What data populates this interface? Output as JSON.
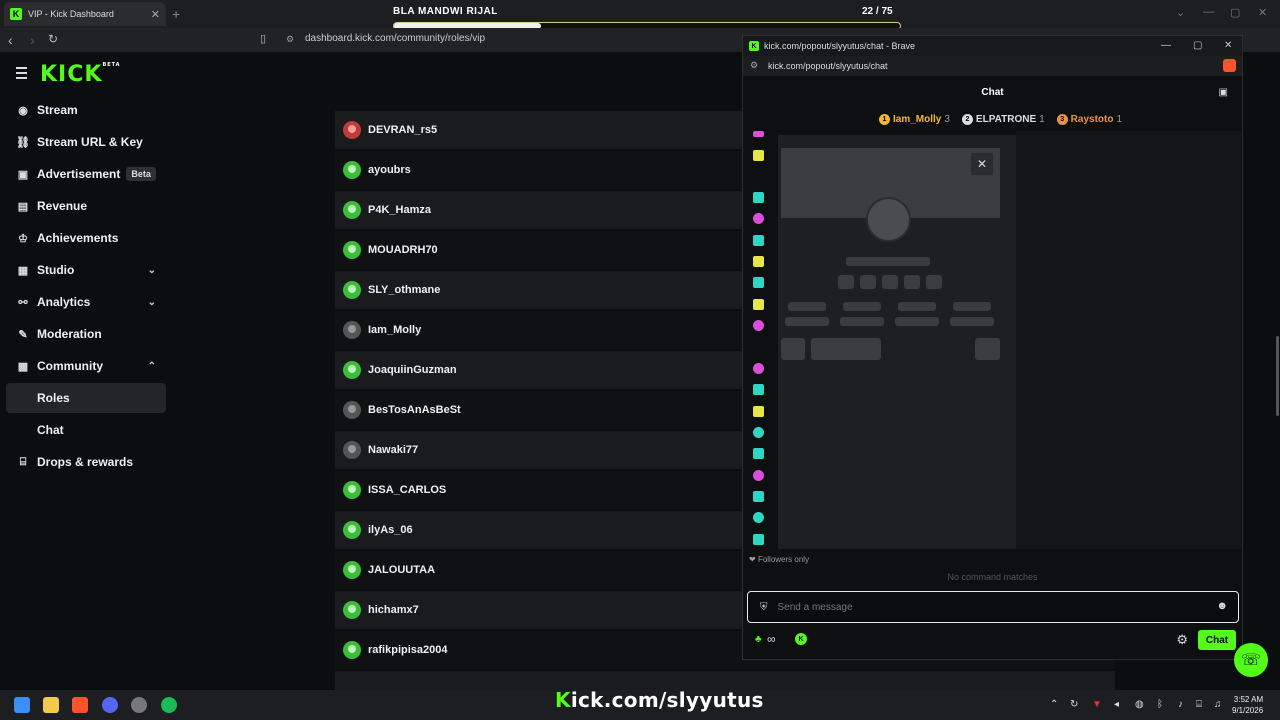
{
  "browser": {
    "tab_title": "VIP - Kick Dashboard",
    "url": "dashboard.kick.com/community/roles/vip"
  },
  "overlay": {
    "title": "BLA MANDWI RIJAL",
    "count": "22 / 75",
    "progress": 0.29
  },
  "sidebar": {
    "items": [
      {
        "label": "Stream",
        "icon": "play-circle-icon"
      },
      {
        "label": "Stream URL & Key",
        "icon": "link-icon"
      },
      {
        "label": "Advertisement",
        "icon": "ad-icon",
        "badge": "Beta"
      },
      {
        "label": "Revenue",
        "icon": "revenue-icon"
      },
      {
        "label": "Achievements",
        "icon": "trophy-icon"
      },
      {
        "label": "Studio",
        "icon": "studio-icon"
      },
      {
        "label": "Analytics",
        "icon": "analytics-icon"
      },
      {
        "label": "Moderation",
        "icon": "wrench-icon"
      },
      {
        "label": "Community",
        "icon": "community-icon"
      },
      {
        "label": "Roles"
      },
      {
        "label": "Chat"
      },
      {
        "label": "Drops & rewards",
        "icon": "gift-icon"
      }
    ]
  },
  "vip_list": [
    "DEVRAN_rs5",
    "ayoubrs",
    "P4K_Hamza",
    "MOUADRH70",
    "SLY_othmane",
    "Iam_Molly",
    "JoaquiinGuzman",
    "BesTosAnAsBeSt",
    "Nawaki77",
    "ISSA_CARLOS",
    "ilyAs_06",
    "JALOUUTAA",
    "hichamx7",
    "rafikpipisa2004"
  ],
  "popout": {
    "window_title": "kick.com/popout/slyyutus/chat - Brave",
    "url": "kick.com/popout/slyyutus/chat",
    "chat_title": "Chat",
    "leaders": [
      {
        "rank": "1",
        "name": "Iam_Molly",
        "count": "3",
        "color": "#f5b82e"
      },
      {
        "rank": "2",
        "name": "ELPATRONE",
        "count": "1",
        "color": "#dddddd"
      },
      {
        "rank": "3",
        "name": "Raystoto",
        "count": "1",
        "color": "#e8914a"
      }
    ],
    "followers_text": "Followers only",
    "no_command": "No command matches",
    "input_placeholder": "Send a message",
    "send_label": "Chat"
  },
  "taskbar": {
    "banner_prefix": "K",
    "banner_rest": "ick.com/slyyutus",
    "time": "3:52 AM",
    "date": "9/1/2026"
  }
}
